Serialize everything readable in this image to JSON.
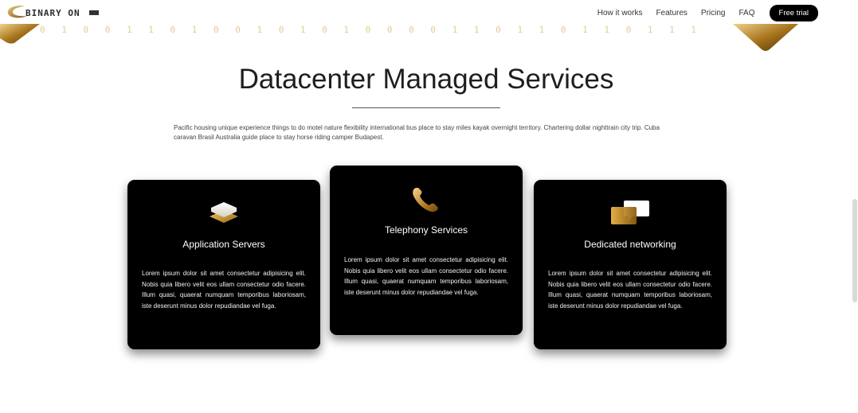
{
  "header": {
    "logo_text": "BINARY ON",
    "nav": [
      {
        "label": "How it works"
      },
      {
        "label": "Features"
      },
      {
        "label": "Pricing"
      },
      {
        "label": "FAQ"
      }
    ],
    "cta_label": "Free trial"
  },
  "decor": {
    "binary_text": "0  1  0  0  1  1  0  1  0  0  1  0  1  0  1  0  0  0  0  1  1  0  1  1  0  1  1  0  1  1  1"
  },
  "section": {
    "title": "Datacenter Managed Services",
    "intro": "Pacific housing unique experience things to do motel nature flexibility international bus place to stay miles kayak overnight territory. Chartering dollar nighttrain city trip. Cuba caravan Brasil Australia guide place to stay horse riding camper Budapest."
  },
  "cards": [
    {
      "icon": "layers-icon",
      "title": "Application Servers",
      "text": "Lorem ipsum dolor sit amet consectetur adipisicing elit. Nobis quia libero velit eos ullam consectetur odio facere. Illum quasi, quaerat numquam temporibus laboriosam, iste deserunt minus dolor repudiandae vel fuga."
    },
    {
      "icon": "phone-icon",
      "title": "Telephony Services",
      "text": "Lorem ipsum dolor sit amet consectetur adipisicing elit. Nobis quia libero velit eos ullam consectetur odio facere. Illum quasi, quaerat numquam temporibus laboriosam, iste deserunt minus dolor repudiandae vel fuga."
    },
    {
      "icon": "chat-bubbles-icon",
      "title": "Dedicated networking",
      "text": "Lorem ipsum dolor sit amet consectetur adipisicing elit. Nobis quia libero velit eos ullam consectetur odio facere. Illum quasi, quaerat numquam temporibus laboriosam, iste deserunt minus dolor repudiandae vel fuga."
    }
  ],
  "colors": {
    "gold": "#c9a24a",
    "card_bg": "#000000",
    "cta_bg": "#000000"
  }
}
